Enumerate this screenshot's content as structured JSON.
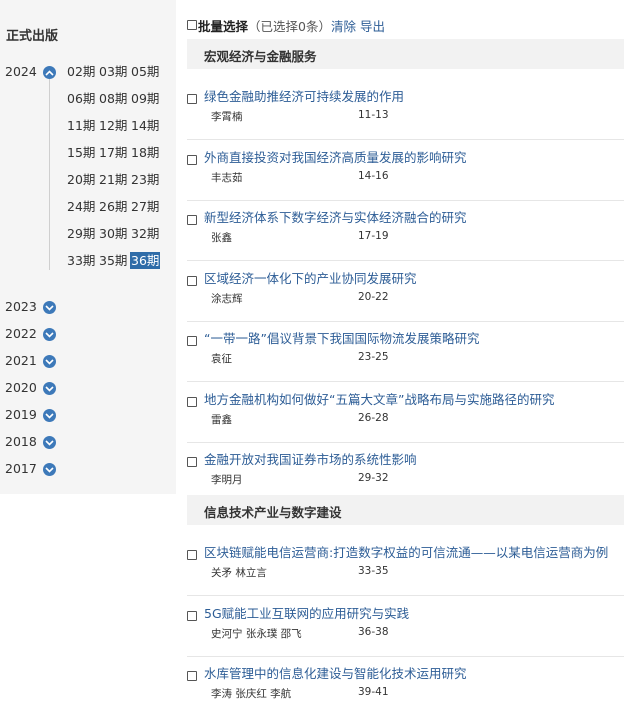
{
  "sidebar": {
    "title": "正式出版",
    "years": [
      {
        "year": "2024",
        "expanded": true,
        "issues": [
          "02期",
          "03期",
          "05期",
          "06期",
          "08期",
          "09期",
          "11期",
          "12期",
          "14期",
          "15期",
          "17期",
          "18期",
          "20期",
          "21期",
          "23期",
          "24期",
          "26期",
          "27期",
          "29期",
          "30期",
          "32期",
          "33期",
          "35期",
          "36期"
        ]
      },
      {
        "year": "2023",
        "expanded": false
      },
      {
        "year": "2022",
        "expanded": false
      },
      {
        "year": "2021",
        "expanded": false
      },
      {
        "year": "2020",
        "expanded": false
      },
      {
        "year": "2019",
        "expanded": false
      },
      {
        "year": "2018",
        "expanded": false
      },
      {
        "year": "2017",
        "expanded": false
      }
    ],
    "selected_issue": "36期",
    "icons": {
      "expanded": "chevron-up-icon",
      "collapsed": "chevron-down-icon"
    },
    "accent_color": "#3d79b9"
  },
  "toolbar": {
    "batch_select": "批量选择",
    "selected_count": "（已选择0条）",
    "clear": "清除",
    "export": "导出"
  },
  "sections": [
    {
      "title": "宏观经济与金融服务",
      "articles": [
        {
          "title": "绿色金融助推经济可持续发展的作用",
          "authors": "李霄楠",
          "pages": "11-13"
        },
        {
          "title": "外商直接投资对我国经济高质量发展的影响研究",
          "authors": "丰志茹",
          "pages": "14-16"
        },
        {
          "title": "新型经济体系下数字经济与实体经济融合的研究",
          "authors": "张鑫",
          "pages": "17-19"
        },
        {
          "title": "区域经济一体化下的产业协同发展研究",
          "authors": "涂志辉",
          "pages": "20-22"
        },
        {
          "title": "“一带一路”倡议背景下我国国际物流发展策略研究",
          "authors": "袁征",
          "pages": "23-25"
        },
        {
          "title": "地方金融机构如何做好“五篇大文章”战略布局与实施路径的研究",
          "authors": "雷鑫",
          "pages": "26-28"
        },
        {
          "title": "金融开放对我国证券市场的系统性影响",
          "authors": "李明月",
          "pages": "29-32"
        }
      ]
    },
    {
      "title": "信息技术产业与数字建设",
      "articles": [
        {
          "title": "区块链赋能电信运营商:打造数字权益的可信流通——以某电信运营商为例",
          "authors": "关矛 林立言",
          "pages": "33-35"
        },
        {
          "title": "5G赋能工业互联网的应用研究与实践",
          "authors": "史河宁 张永璞 邵飞",
          "pages": "36-38"
        },
        {
          "title": "水库管理中的信息化建设与智能化技术运用研究",
          "authors": "李涛 张庆红 李航",
          "pages": "39-41"
        }
      ]
    }
  ]
}
